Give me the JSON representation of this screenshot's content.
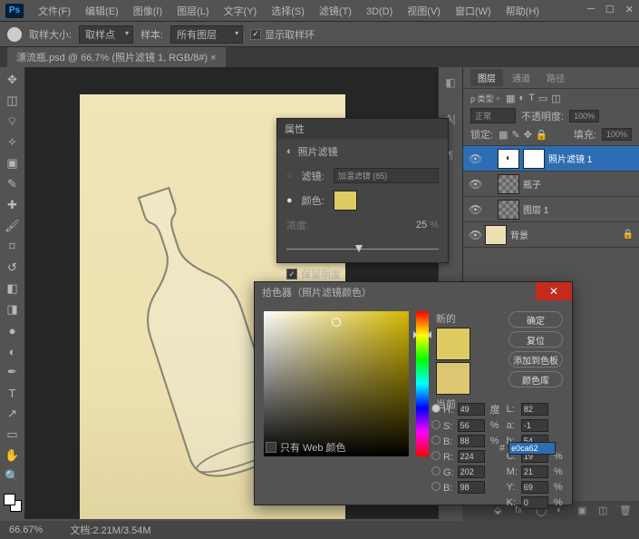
{
  "menu": [
    "文件(F)",
    "编辑(E)",
    "图像(I)",
    "图层(L)",
    "文字(Y)",
    "选择(S)",
    "滤镜(T)",
    "3D(D)",
    "视图(V)",
    "窗口(W)",
    "帮助(H)"
  ],
  "opt": {
    "size_label": "取样大小:",
    "size_value": "取样点",
    "sample_label": "样本:",
    "sample_value": "所有图层",
    "show_ring": "显示取样环"
  },
  "doc": {
    "tab": "漂流瓶.psd @ 66.7% (照片滤镜 1, RGB/8#) ×"
  },
  "panel": {
    "tabs": [
      "图层",
      "通道",
      "路径"
    ],
    "blend": "正常",
    "opacity_label": "不透明度:",
    "opacity": "100%",
    "fill_label": "填充:",
    "fill": "100%",
    "lock": "锁定:"
  },
  "layers": [
    {
      "name": "照片滤镜 1",
      "sel": true,
      "adj": true,
      "mask": true,
      "indent": 1
    },
    {
      "name": "瓶子",
      "thumb": "chk",
      "indent": 1
    },
    {
      "name": "图层 1",
      "thumb": "chk",
      "indent": 1
    },
    {
      "name": "背景",
      "thumb": "paper",
      "lock": true
    }
  ],
  "props": {
    "title": "属性",
    "sub": "照片滤镜",
    "filter_label": "滤镜:",
    "filter_value": "加温滤镜 (85)",
    "color_label": "颜色:",
    "density_label": "浓度:",
    "density": "25",
    "preserve": "保留明度"
  },
  "picker": {
    "title": "拾色器（照片滤镜颜色）",
    "new": "新的",
    "cur": "当前",
    "btns": [
      "确定",
      "复位",
      "添加到色板",
      "颜色库"
    ],
    "H": "49",
    "S": "56",
    "B": "88",
    "R": "224",
    "G": "202",
    "Bb": "98",
    "L": "82",
    "a": "-1",
    "b": "54",
    "C": "19",
    "M": "21",
    "Y": "69",
    "K": "0",
    "hex": "e0ca62",
    "webonly": "只有 Web 颜色",
    "deg": "度",
    "pct": "%"
  },
  "status": {
    "zoom": "66.67%",
    "doc": "文档:2.21M/3.54M"
  }
}
